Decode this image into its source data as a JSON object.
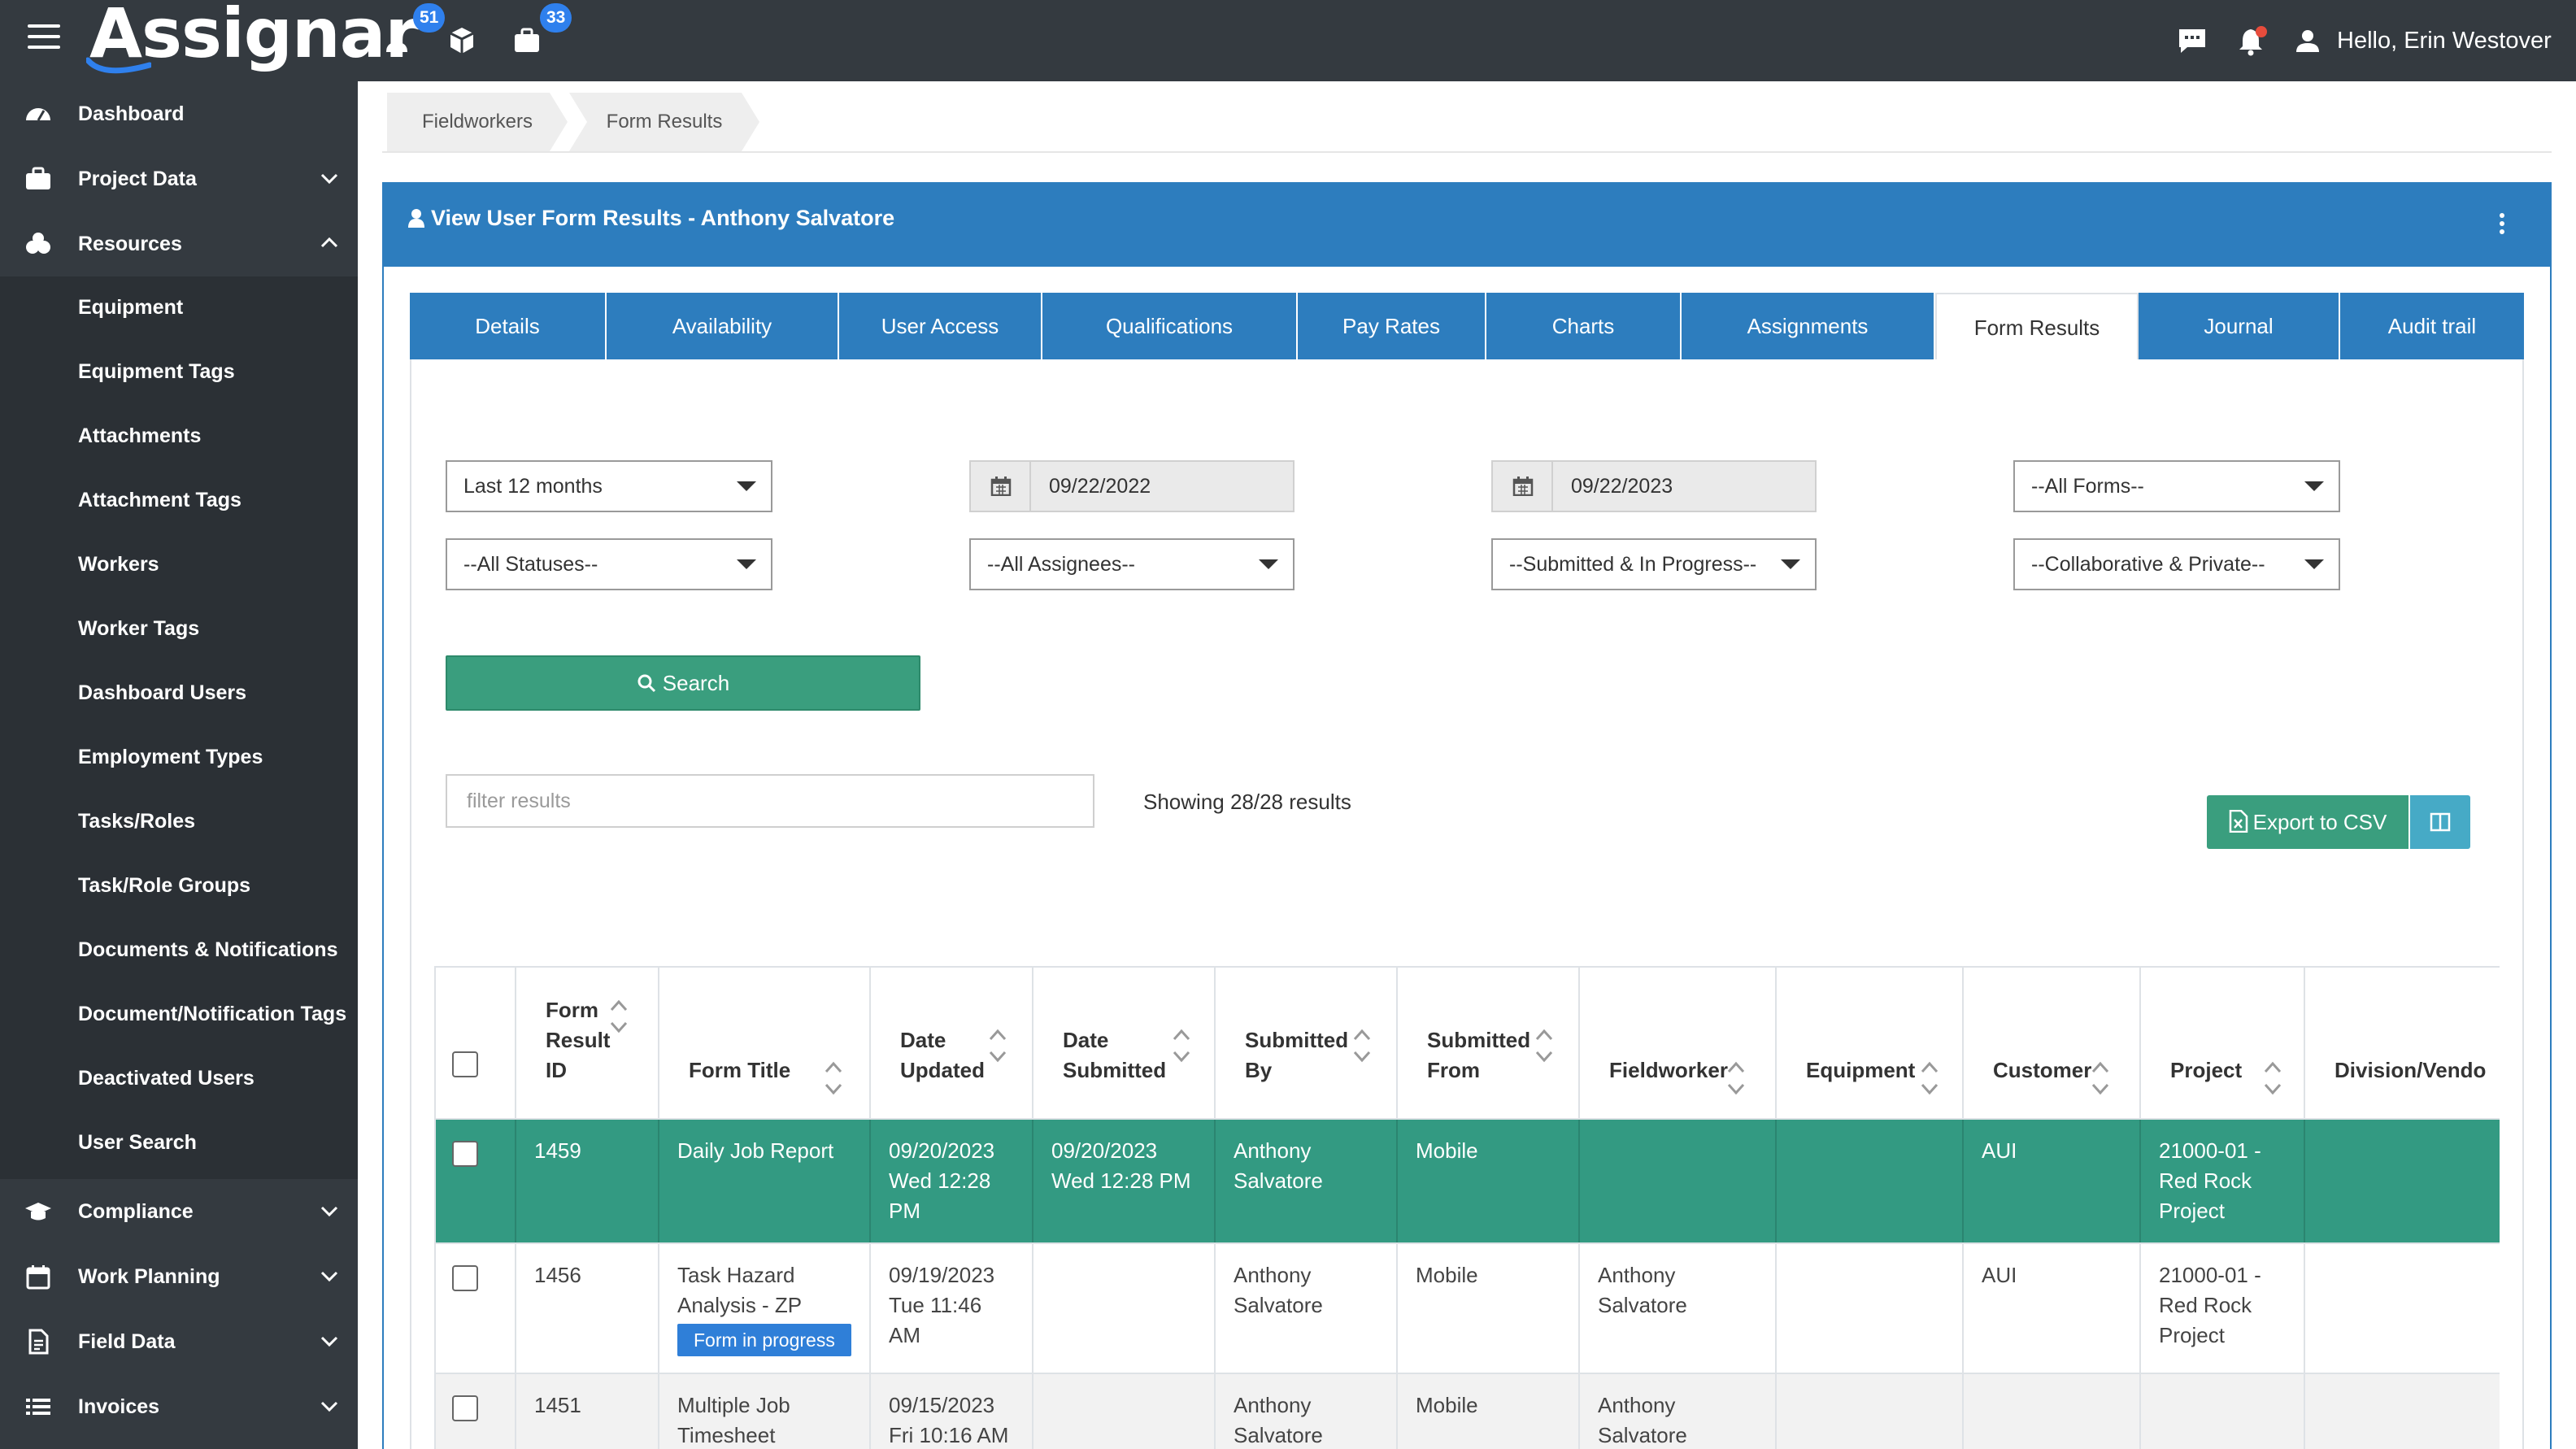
{
  "app": {
    "name": "Assignar",
    "greeting": "Hello, Erin Westover"
  },
  "topbar": {
    "badges": {
      "workers": "51",
      "assignments": "33"
    }
  },
  "sidebar": {
    "main": [
      {
        "label": "Dashboard",
        "icon": "dashboard-icon"
      },
      {
        "label": "Project Data",
        "icon": "briefcase-icon"
      },
      {
        "label": "Resources",
        "icon": "resources-icon"
      }
    ],
    "resources_items": [
      "Equipment",
      "Equipment Tags",
      "Attachments",
      "Attachment Tags",
      "Workers",
      "Worker Tags",
      "Dashboard Users",
      "Employment Types",
      "Tasks/Roles",
      "Task/Role Groups",
      "Documents & Notifications",
      "Document/Notification Tags",
      "Deactivated Users",
      "User Search"
    ],
    "bottom": [
      {
        "label": "Compliance",
        "icon": "graduation-cap-icon"
      },
      {
        "label": "Work Planning",
        "icon": "calendar-icon"
      },
      {
        "label": "Field Data",
        "icon": "document-icon"
      },
      {
        "label": "Invoices",
        "icon": "list-icon"
      }
    ]
  },
  "breadcrumb": [
    "Fieldworkers",
    "Form Results"
  ],
  "panel": {
    "title": "View User Form Results - Anthony Salvatore"
  },
  "tabs": [
    "Details",
    "Availability",
    "User Access",
    "Qualifications",
    "Pay Rates",
    "Charts",
    "Assignments",
    "Form Results",
    "Journal",
    "Audit trail"
  ],
  "active_tab": "Form Results",
  "filters": {
    "period": "Last 12 months",
    "date_from": "09/22/2022",
    "date_to": "09/22/2023",
    "forms": "--All Forms--",
    "statuses": "--All Statuses--",
    "assignees": "--All Assignees--",
    "submission": "--Submitted & In Progress--",
    "visibility": "--Collaborative & Private--"
  },
  "search_label": "Search",
  "filter_placeholder": "filter results",
  "showing": "Showing 28/28 results",
  "export_label": "Export to CSV",
  "table": {
    "headers": {
      "id": [
        "Form",
        "Result",
        "ID"
      ],
      "title": [
        "Form Title"
      ],
      "updated": [
        "Date",
        "Updated"
      ],
      "submitted": [
        "Date",
        "Submitted"
      ],
      "by": [
        "Submitted",
        "By"
      ],
      "from": [
        "Submitted",
        "From"
      ],
      "fieldworker": [
        "Fieldworker"
      ],
      "equipment": [
        "Equipment"
      ],
      "customer": [
        "Customer"
      ],
      "project": [
        "Project"
      ],
      "division": [
        "Division/Vendo"
      ]
    },
    "rows": [
      {
        "id": "1459",
        "title": "Daily Job Report",
        "status": "",
        "updated": "09/20/2023 Wed 12:28 PM",
        "submitted": "09/20/2023 Wed 12:28 PM",
        "by": "Anthony Salvatore",
        "from": "Mobile",
        "fieldworker": "",
        "equipment": "",
        "customer": "AUI",
        "project": "21000-01 - Red Rock Project",
        "division": ""
      },
      {
        "id": "1456",
        "title": "Task Hazard Analysis - ZP",
        "status": "Form in progress",
        "updated": "09/19/2023 Tue 11:46 AM",
        "submitted": "",
        "by": "Anthony Salvatore",
        "from": "Mobile",
        "fieldworker": "Anthony Salvatore",
        "equipment": "",
        "customer": "AUI",
        "project": "21000-01 - Red Rock Project",
        "division": ""
      },
      {
        "id": "1451",
        "title": "Multiple Job Timesheet",
        "status": "",
        "updated": "09/15/2023 Fri 10:16 AM",
        "submitted": "",
        "by": "Anthony Salvatore",
        "from": "Mobile",
        "fieldworker": "Anthony Salvatore",
        "equipment": "",
        "customer": "",
        "project": "",
        "division": ""
      }
    ]
  },
  "colors": {
    "topbar": "#343a40",
    "accent_blue": "#2d7dbe",
    "green": "#3a9e7e",
    "selected_row": "#339a82"
  }
}
